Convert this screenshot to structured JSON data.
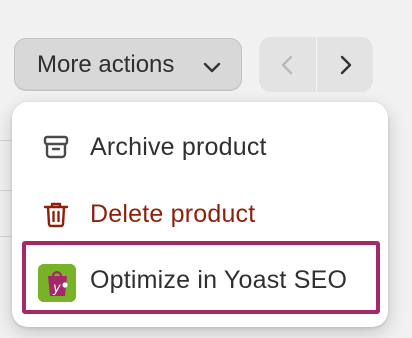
{
  "toolbar": {
    "more_actions_label": "More actions",
    "more_actions_icon": "chevron-down-icon",
    "prev_icon": "chevron-left-icon",
    "next_icon": "chevron-right-icon"
  },
  "menu": {
    "items": [
      {
        "label": "Archive product",
        "icon": "archive-icon",
        "color": "#303030"
      },
      {
        "label": "Delete product",
        "icon": "trash-icon",
        "color": "#8e1f0b"
      },
      {
        "label": "Optimize in Yoast SEO",
        "icon": "yoast-logo-icon",
        "color": "#303030",
        "highlighted": true
      }
    ]
  },
  "colors": {
    "highlight_border": "#a4286a",
    "yoast_green": "#77b227",
    "yoast_purple": "#a4286a",
    "destructive": "#8e1f0b"
  }
}
